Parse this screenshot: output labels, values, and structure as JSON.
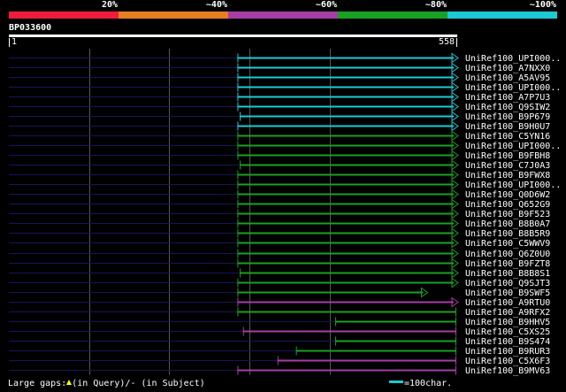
{
  "legend": {
    "segments": [
      {
        "label": "20%",
        "color": "#ee1c3c"
      },
      {
        "label": "~40%",
        "color": "#e67e22"
      },
      {
        "label": "~60%",
        "color": "#a63ea6"
      },
      {
        "label": "~80%",
        "color": "#1aa024"
      },
      {
        "label": "~100%",
        "color": "#1ccad4"
      }
    ]
  },
  "query": {
    "id": "BP033600",
    "start": "1",
    "end": "558",
    "length": 558
  },
  "colors": {
    "guide": "#16165a",
    "grid": "#565656"
  },
  "grid_positions": [
    100,
    200,
    300,
    400
  ],
  "hits": [
    {
      "name": "UniRef100_UPI000..",
      "start": 285,
      "end": 558,
      "color": "#1ccad4",
      "arrow": true
    },
    {
      "name": "UniRef100_A7NXX0",
      "start": 285,
      "end": 558,
      "color": "#1ccad4",
      "arrow": true
    },
    {
      "name": "UniRef100_A5AV95",
      "start": 285,
      "end": 558,
      "color": "#1ccad4",
      "arrow": true
    },
    {
      "name": "UniRef100_UPI000..",
      "start": 285,
      "end": 558,
      "color": "#1ccad4",
      "arrow": true
    },
    {
      "name": "UniRef100_A7P7U3",
      "start": 285,
      "end": 558,
      "color": "#1ccad4",
      "arrow": true
    },
    {
      "name": "UniRef100_Q9SIW2",
      "start": 285,
      "end": 558,
      "color": "#1ccad4",
      "arrow": true
    },
    {
      "name": "UniRef100_B9P679",
      "start": 288,
      "end": 558,
      "color": "#1ccad4",
      "arrow": true
    },
    {
      "name": "UniRef100_B9H0U7",
      "start": 285,
      "end": 558,
      "color": "#1ccad4",
      "arrow": true
    },
    {
      "name": "UniRef100_C5YN16",
      "start": 285,
      "end": 558,
      "color": "#1aa024",
      "arrow": true
    },
    {
      "name": "UniRef100_UPI000..",
      "start": 285,
      "end": 558,
      "color": "#1aa024",
      "arrow": true
    },
    {
      "name": "UniRef100_B9FBH8",
      "start": 285,
      "end": 558,
      "color": "#1aa024",
      "arrow": true
    },
    {
      "name": "UniRef100_C7J0A3",
      "start": 288,
      "end": 558,
      "color": "#1aa024",
      "arrow": true
    },
    {
      "name": "UniRef100_B9FWX8",
      "start": 285,
      "end": 558,
      "color": "#1aa024",
      "arrow": true
    },
    {
      "name": "UniRef100_UPI000..",
      "start": 285,
      "end": 558,
      "color": "#1aa024",
      "arrow": true
    },
    {
      "name": "UniRef100_Q0D6W2",
      "start": 285,
      "end": 558,
      "color": "#1aa024",
      "arrow": true
    },
    {
      "name": "UniRef100_Q652G9",
      "start": 285,
      "end": 558,
      "color": "#1aa024",
      "arrow": true
    },
    {
      "name": "UniRef100_B9F523",
      "start": 285,
      "end": 558,
      "color": "#1aa024",
      "arrow": true
    },
    {
      "name": "UniRef100_B8B0A7",
      "start": 285,
      "end": 558,
      "color": "#1aa024",
      "arrow": true
    },
    {
      "name": "UniRef100_B8B5R9",
      "start": 285,
      "end": 558,
      "color": "#1aa024",
      "arrow": true
    },
    {
      "name": "UniRef100_C5WWV9",
      "start": 285,
      "end": 558,
      "color": "#1aa024",
      "arrow": true
    },
    {
      "name": "UniRef100_Q6Z0U0",
      "start": 285,
      "end": 558,
      "color": "#1aa024",
      "arrow": true
    },
    {
      "name": "UniRef100_B9FZT8",
      "start": 285,
      "end": 558,
      "color": "#1aa024",
      "arrow": true
    },
    {
      "name": "UniRef100_B8B8S1",
      "start": 288,
      "end": 558,
      "color": "#1aa024",
      "arrow": true
    },
    {
      "name": "UniRef100_Q9SJT3",
      "start": 285,
      "end": 558,
      "color": "#1aa024",
      "arrow": true
    },
    {
      "name": "UniRef100_B9SWF5",
      "start": 285,
      "end": 520,
      "color": "#1aa024",
      "arrow": true
    },
    {
      "name": "UniRef100_A9RTU0",
      "start": 285,
      "end": 558,
      "color": "#a63ea6",
      "arrow": true
    },
    {
      "name": "UniRef100_A9RFX2",
      "start": 285,
      "end": 558,
      "color": "#1aa024",
      "arrow": false
    },
    {
      "name": "UniRef100_B9HHV5",
      "start": 407,
      "end": 558,
      "color": "#1aa024",
      "arrow": false
    },
    {
      "name": "UniRef100_C5XS25",
      "start": 292,
      "end": 558,
      "color": "#a63ea6",
      "arrow": false
    },
    {
      "name": "UniRef100_B9S474",
      "start": 407,
      "end": 558,
      "color": "#1aa024",
      "arrow": false
    },
    {
      "name": "UniRef100_B9RUR3",
      "start": 358,
      "end": 558,
      "color": "#1aa024",
      "arrow": false
    },
    {
      "name": "UniRef100_C5X6F3",
      "start": 335,
      "end": 558,
      "color": "#a63ea6",
      "arrow": false
    },
    {
      "name": "UniRef100_B9MV63",
      "start": 285,
      "end": 558,
      "color": "#a63ea6",
      "arrow": false
    }
  ],
  "footer": {
    "gaps_prefix": "Large gaps:",
    "gaps_suffix": "(in Query)/- (in Subject)",
    "scale_label": "=100char.",
    "scale_color": "#1ccad4"
  }
}
